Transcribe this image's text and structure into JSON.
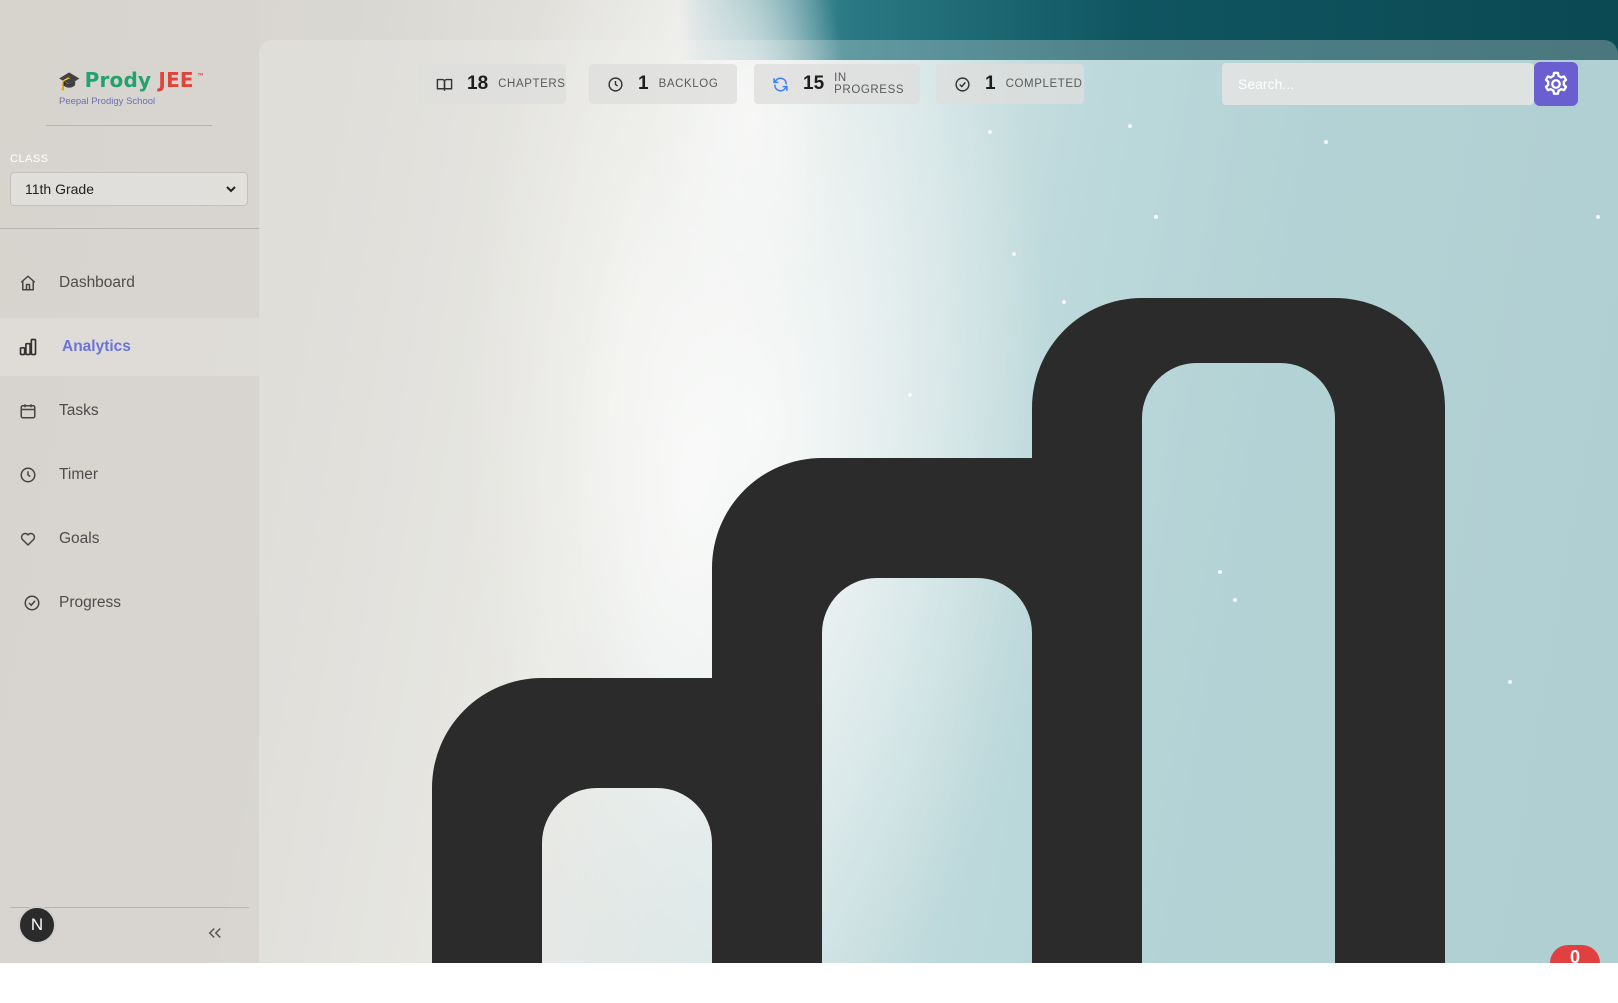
{
  "brand": {
    "icon": "graduation-cap-icon",
    "name_part1": "Prody",
    "name_part2": "JEE",
    "trademark": "™",
    "subtitle": "Peepal Prodigy School"
  },
  "class_selector": {
    "label": "CLASS",
    "selected": "11th Grade"
  },
  "nav": {
    "items": [
      {
        "label": "Dashboard",
        "icon": "home-icon",
        "active": false
      },
      {
        "label": "Analytics",
        "icon": "bar-chart-icon",
        "active": true
      },
      {
        "label": "Tasks",
        "icon": "calendar-icon",
        "active": false
      },
      {
        "label": "Timer",
        "icon": "clock-icon",
        "active": false
      },
      {
        "label": "Goals",
        "icon": "heart-icon",
        "active": false
      },
      {
        "label": "Progress",
        "icon": "check-circle-icon",
        "active": false
      }
    ]
  },
  "user": {
    "avatar_letter": "N"
  },
  "stats": [
    {
      "value": "18",
      "label": "CHAPTERS",
      "icon": "book-icon"
    },
    {
      "value": "1",
      "label": "BACKLOG",
      "icon": "clock-icon"
    },
    {
      "value": "15",
      "label": "IN PROGRESS",
      "icon": "refresh-icon"
    },
    {
      "value": "1",
      "label": "COMPLETED",
      "icon": "check-circle-icon"
    }
  ],
  "search": {
    "placeholder": "Search...",
    "value": ""
  },
  "notification": {
    "count": "0"
  },
  "colors": {
    "accent": "#6b73d6",
    "settings_button": "#6a5fd0",
    "brand_green": "#22a36c",
    "brand_red": "#e0433a",
    "notification": "#e04040",
    "progress_icon": "#3b82f6"
  }
}
